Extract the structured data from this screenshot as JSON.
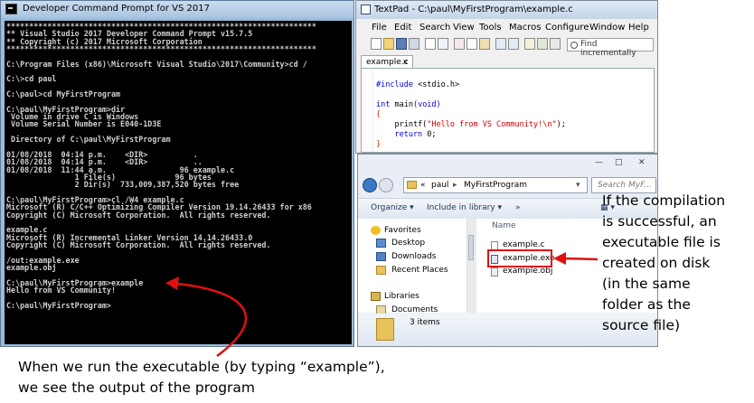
{
  "cmd": {
    "title": "Developer Command Prompt for VS 2017",
    "lines": [
      "********************************************************************",
      "** Visual Studio 2017 Developer Command Prompt v15.7.5",
      "** Copyright (c) 2017 Microsoft Corporation",
      "********************************************************************",
      "",
      "C:\\Program Files (x86)\\Microsoft Visual Studio\\2017\\Community>cd /",
      "",
      "C:\\>cd paul",
      "",
      "C:\\paul>cd MyFirstProgram",
      "",
      "C:\\paul\\MyFirstProgram>dir",
      " Volume in drive C is Windows",
      " Volume Serial Number is E040-1D3E",
      "",
      " Directory of C:\\paul\\MyFirstProgram",
      "",
      "01/08/2018  04:14 p.m.    <DIR>          .",
      "01/08/2018  04:14 p.m.    <DIR>          ..",
      "01/08/2018  11:44 a.m.                96 example.c",
      "               1 File(s)             96 bytes",
      "               2 Dir(s)  733,009,387,520 bytes free",
      "",
      "C:\\paul\\MyFirstProgram>cl /W4 example.c",
      "Microsoft (R) C/C++ Optimizing Compiler Version 19.14.26433 for x86",
      "Copyright (C) Microsoft Corporation.  All rights reserved.",
      "",
      "example.c",
      "Microsoft (R) Incremental Linker Version 14.14.26433.0",
      "Copyright (C) Microsoft Corporation.  All rights reserved.",
      "",
      "/out:example.exe",
      "example.obj",
      "",
      "C:\\paul\\MyFirstProgram>example",
      "Hello from VS Community!",
      "",
      "C:\\paul\\MyFirstProgram>"
    ]
  },
  "textpad": {
    "title": "TextPad - C:\\paul\\MyFirstProgram\\example.c",
    "menu": [
      "File",
      "Edit",
      "Search",
      "View",
      "Tools",
      "Macros",
      "Configure",
      "Window",
      "Help"
    ],
    "find_placeholder": "Find incrementally",
    "tab_label": "example.c",
    "tab_close": "×",
    "code": {
      "l1_kw": "#include",
      "l1_rest": " <stdio.h>",
      "l2_kw": "int",
      "l2_name": " main",
      "l2_paren": "(void)",
      "l3": "{",
      "l4_fn": "    printf(",
      "l4_str": "\"Hello from VS Community!\\n\"",
      "l4_end": ");",
      "l5_kw": "    return",
      "l5_rest": " 0;",
      "l6": "}"
    }
  },
  "explorer": {
    "window_buttons": [
      "—",
      "□",
      "✕"
    ],
    "breadcrumb": [
      "«",
      "paul",
      "▸",
      "MyFirstProgram",
      "▾"
    ],
    "search_placeholder": "Search MyF...",
    "commands": [
      "Organize ▾",
      "Include in library ▾",
      "»",
      "▦ ▾"
    ],
    "nav": {
      "favorites": "Favorites",
      "desktop": "Desktop",
      "downloads": "Downloads",
      "recent": "Recent Places",
      "libraries": "Libraries",
      "documents": "Documents"
    },
    "column_name": "Name",
    "files": [
      "example.c",
      "example.exe",
      "example.obj"
    ],
    "status": "3 items"
  },
  "annotations": {
    "right": [
      "If the compilation",
      "is successful, an",
      "executable file is",
      "created on disk",
      "(in the same",
      "folder as the",
      "source file)"
    ],
    "bottom": [
      "When we run the executable (by typing “example”),",
      "we see the output of the program"
    ]
  },
  "colors": {
    "arrow": "#e01010",
    "console_bg": "#000000",
    "console_fg": "#cfcfcf"
  }
}
